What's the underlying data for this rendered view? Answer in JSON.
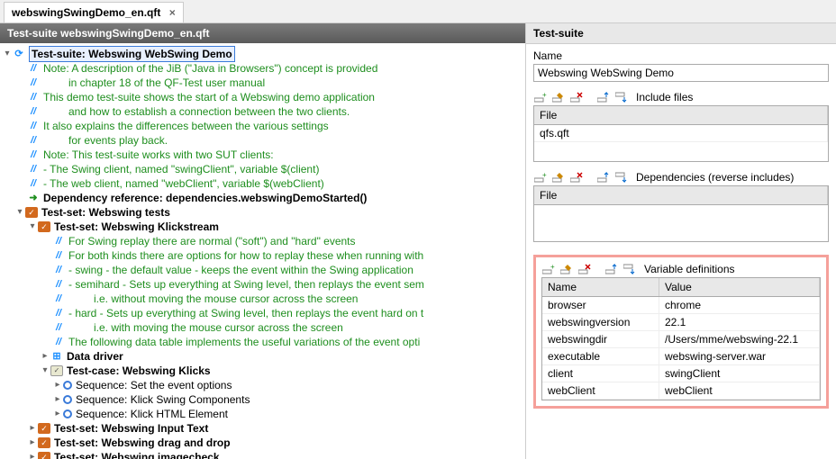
{
  "tab": {
    "title": "webswingSwingDemo_en.qft",
    "close": "×"
  },
  "left_header": "Test-suite webswingSwingDemo_en.qft",
  "tree": {
    "root": "Test-suite: Webswing WebSwing Demo",
    "c1": "Note: A description of the JiB (\"Java in Browsers\") concept is provided",
    "c1b": "in chapter 18 of the QF-Test user manual",
    "c2": "This demo test-suite shows the start of a Webswing demo application",
    "c2b": "and how to establish a connection between the two clients.",
    "c3": "It also explains the differences between the various settings",
    "c3b": "for events play back.",
    "c4": "Note: This test-suite works with two SUT clients:",
    "c5": "- The Swing client, named \"swingClient\", variable $(client)",
    "c6": "- The web client, named \"webClient\", variable $(webClient)",
    "dep": "Dependency reference: dependencies.webswingDemoStarted()",
    "ts1": "Test-set: Webswing tests",
    "ts2": "Test-set: Webswing Klickstream",
    "k1": "For Swing replay there are normal (\"soft\") and \"hard\" events",
    "k2": "For both kinds there are options for how to replay these when running with",
    "k3": "- swing - the default value - keeps the event within the Swing application",
    "k4": "- semihard - Sets up everything at Swing level, then replays the event sem",
    "k4b": "i.e. without moving the mouse cursor across the screen",
    "k5": "- hard - Sets up everything at Swing level, then replays the event hard on t",
    "k5b": "i.e. with moving the mouse cursor across the screen",
    "k6": "The following data table implements the useful variations of the event opti",
    "dd": "Data driver",
    "tc": "Test-case: Webswing Klicks",
    "sq1": "Sequence: Set the event options",
    "sq2": "Sequence: Klick Swing Components",
    "sq3": "Sequence: Klick HTML Element",
    "ts3": "Test-set: Webswing Input Text",
    "ts4": "Test-set: Webswing drag and drop",
    "ts5": "Test-set: Webswing imagecheck"
  },
  "right": {
    "header": "Test-suite",
    "name_label": "Name",
    "name_value": "Webswing WebSwing Demo",
    "include_title": "Include files",
    "include_col": "File",
    "include_rows": [
      "qfs.qft"
    ],
    "deps_title": "Dependencies (reverse includes)",
    "deps_col": "File",
    "vardef_title": "Variable definitions",
    "vardef_cols": {
      "name": "Name",
      "value": "Value"
    },
    "vars": [
      {
        "name": "browser",
        "value": "chrome"
      },
      {
        "name": "webswingversion",
        "value": "22.1"
      },
      {
        "name": "webswingdir",
        "value": "/Users/mme/webswing-22.1"
      },
      {
        "name": "executable",
        "value": "webswing-server.war"
      },
      {
        "name": "client",
        "value": "swingClient"
      },
      {
        "name": "webClient",
        "value": "webClient"
      }
    ]
  }
}
